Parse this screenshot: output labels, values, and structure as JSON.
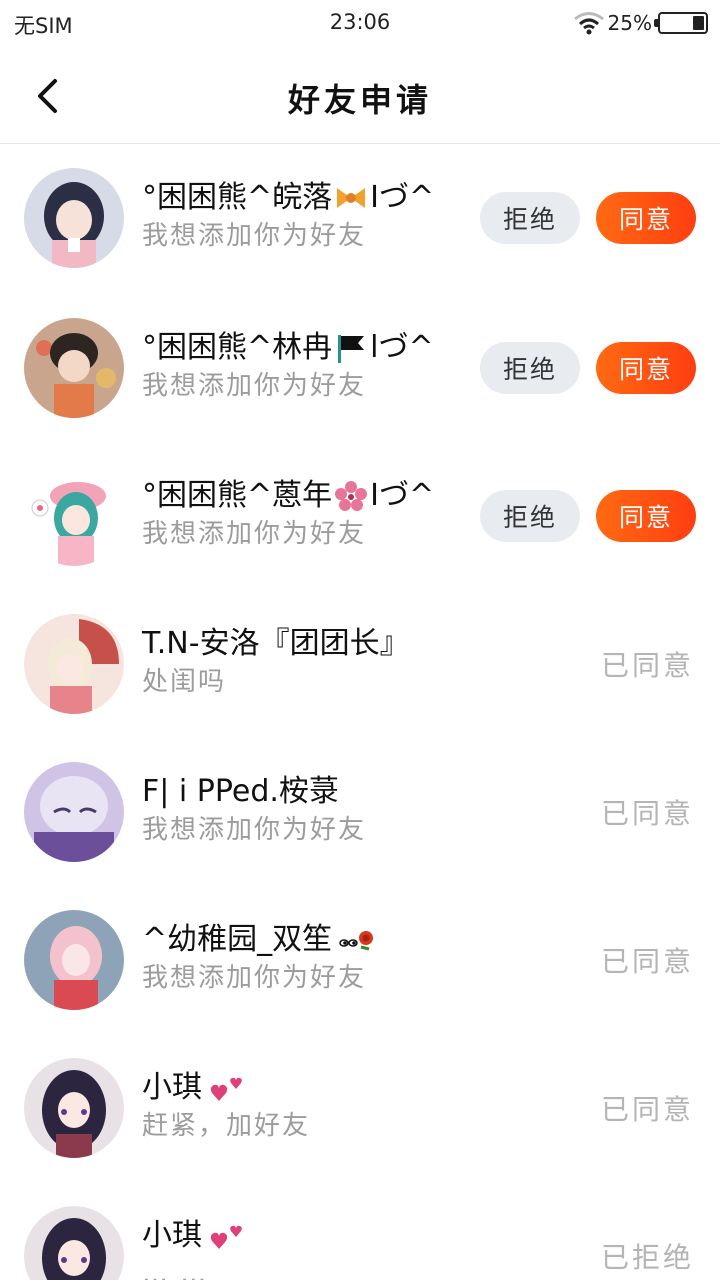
{
  "status_bar": {
    "carrier": "无SIM",
    "time": "23:06",
    "battery": "25%",
    "battery_level": 0.25
  },
  "header": {
    "title": "好友申请",
    "back_icon": "back-arrow-icon"
  },
  "buttons": {
    "reject": "拒绝",
    "accept": "同意"
  },
  "colors": {
    "accent": "#ff5014",
    "reject_bg": "#e8ecf0",
    "status_gray": "#b4b4b4"
  },
  "requests": [
    {
      "name": "°困困熊^皖落",
      "name_tail": "Iづ^",
      "emoji": "ribbon-emoji",
      "message": "我想添加你为好友",
      "state": "pending"
    },
    {
      "name": "°困困熊^林冉",
      "name_tail": "lづ^",
      "emoji": "black-flag-emoji",
      "message": "我想添加你为好友",
      "state": "pending"
    },
    {
      "name": "°困困熊^蒽年",
      "name_tail": "Iづ^",
      "emoji": "cherry-blossom-emoji",
      "message": "我想添加你为好友",
      "state": "pending"
    },
    {
      "name": "T.N-安洛『团团长』",
      "name_tail": "",
      "emoji": "",
      "message": "处闺吗",
      "state": "已同意"
    },
    {
      "name": "F| i PPed.桉菉",
      "name_tail": "",
      "emoji": "",
      "message": "我想添加你为好友",
      "state": "已同意"
    },
    {
      "name": "^幼稚园_双笙",
      "name_tail": "",
      "emoji": "eyes-rose-emoji",
      "message": "我想添加你为好友",
      "state": "已同意"
    },
    {
      "name": "小琪",
      "name_tail": "",
      "emoji": "two-hearts-emoji",
      "message": "赶紧，加好友",
      "state": "已同意"
    },
    {
      "name": "小琪",
      "name_tail": "",
      "emoji": "two-hearts-emoji",
      "message": "… …",
      "state": "已拒绝"
    }
  ]
}
